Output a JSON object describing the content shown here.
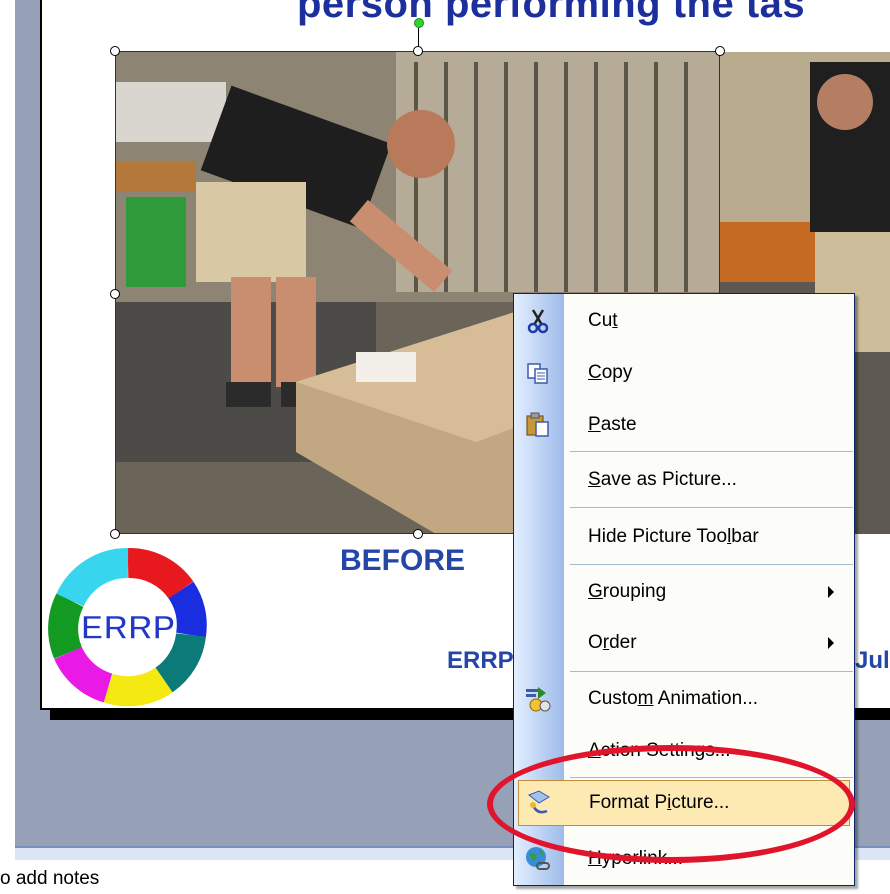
{
  "slide": {
    "title_fragment": "person performing the tas",
    "caption_before": "BEFORE",
    "footer_left": "ERRP",
    "footer_right": "Jul",
    "logo_text": "ERRP"
  },
  "notes": {
    "placeholder": "o add notes"
  },
  "context_menu": {
    "items": [
      {
        "label": "Cut",
        "icon": "scissors-icon"
      },
      {
        "label": "Copy",
        "icon": "copy-icon"
      },
      {
        "label": "Paste",
        "icon": "paste-icon"
      },
      {
        "label": "Save as Picture...",
        "icon": ""
      },
      {
        "label": "Hide Picture Toolbar",
        "icon": ""
      },
      {
        "label": "Grouping",
        "icon": "",
        "submenu": true
      },
      {
        "label": "Order",
        "icon": "",
        "submenu": true
      },
      {
        "label": "Custom Animation...",
        "icon": "custom-animation-icon"
      },
      {
        "label": "Action Settings...",
        "icon": ""
      },
      {
        "label": "Format Picture...",
        "icon": "format-picture-icon",
        "highlighted": true
      },
      {
        "label": "Hyperlink...",
        "icon": "hyperlink-icon"
      }
    ]
  },
  "colors": {
    "workspace": "#96a0b7",
    "title": "#1c2f9c",
    "caption": "#2645a8",
    "menu_highlight": "#fde9b2",
    "annotation_circle": "#e0142b"
  }
}
